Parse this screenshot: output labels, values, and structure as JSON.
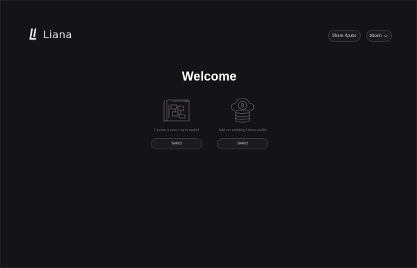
{
  "app": {
    "name": "Liana"
  },
  "header": {
    "share_xpubs_label": "Share Xpubs",
    "network_selected": "bitcoin"
  },
  "welcome": {
    "title": "Welcome",
    "options": [
      {
        "description": "Create a new Liana wallet",
        "button_label": "Select",
        "icon": "blueprint-icon"
      },
      {
        "description": "Add an existing Liana wallet",
        "button_label": "Select",
        "icon": "database-cloud-bitcoin-icon"
      }
    ]
  }
}
